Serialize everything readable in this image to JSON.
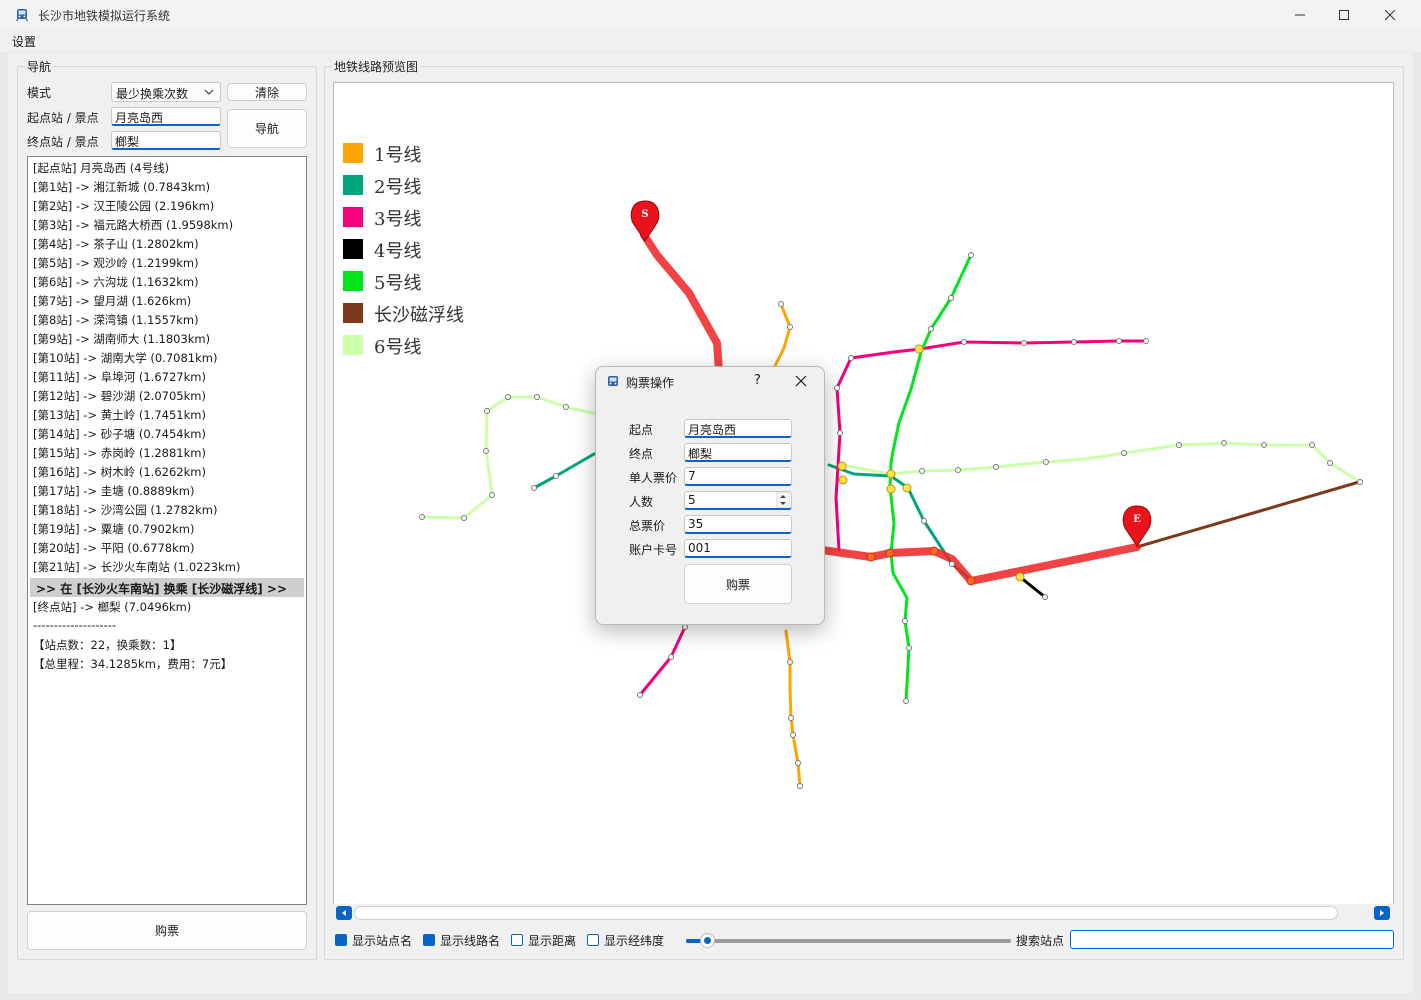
{
  "window": {
    "title": "长沙市地铁模拟运行系统"
  },
  "menu": {
    "settings": "设置"
  },
  "nav": {
    "group_title": "导航",
    "mode_label": "模式",
    "mode_value": "最少换乘次数",
    "clear_button": "清除",
    "start_label": "起点站 / 景点",
    "start_value": "月亮岛西",
    "end_label": "终点站 / 景点",
    "end_value": "榔梨",
    "navigate_button": "导航",
    "buy_button": "购票"
  },
  "route": {
    "lines": [
      "[起点站] 月亮岛西 (4号线)",
      "[第1站] -> 湘江新城  (0.7843km)",
      "[第2站] -> 汉王陵公园  (2.196km)",
      "[第3站] -> 福元路大桥西  (1.9598km)",
      "[第4站] -> 茶子山  (1.2802km)",
      "[第5站] -> 观沙岭  (1.2199km)",
      "[第6站] -> 六沟垅  (1.1632km)",
      "[第7站] -> 望月湖  (1.626km)",
      "[第8站] -> 溁湾镇  (1.1557km)",
      "[第9站] -> 湖南师大  (1.1803km)",
      "[第10站] -> 湖南大学  (0.7081km)",
      "[第11站] -> 阜埠河  (1.6727km)",
      "[第12站] -> 碧沙湖  (2.0705km)",
      "[第13站] -> 黄土岭  (1.7451km)",
      "[第14站] -> 砂子塘  (0.7454km)",
      "[第15站] -> 赤岗岭  (1.2881km)",
      "[第16站] -> 树木岭  (1.6262km)",
      "[第17站] -> 圭塘  (0.8889km)",
      "[第18站] -> 沙湾公园  (1.2782km)",
      "[第19站] -> 粟塘  (0.7902km)",
      "[第20站] -> 平阳  (0.6778km)",
      "[第21站] -> 长沙火车南站  (1.0223km)"
    ],
    "transfer": ">> 在 [长沙火车南站] 换乘 [长沙磁浮线] >>",
    "end_line": "[终点站] -> 榔梨  (7.0496km)",
    "divider": "--------------------",
    "summary1": "【站点数：22，换乘数：1】",
    "summary2": "【总里程：34.1285km，费用：7元】"
  },
  "map": {
    "group_title": "地铁线路预览图",
    "start_marker": "S",
    "end_marker": "E",
    "legend": [
      {
        "name": "1号线",
        "color": "#ffa500"
      },
      {
        "name": "2号线",
        "color": "#00a57e"
      },
      {
        "name": "3号线",
        "color": "#f5007a"
      },
      {
        "name": "4号线",
        "color": "#000000"
      },
      {
        "name": "5号线",
        "color": "#00e51e"
      },
      {
        "name": "长沙磁浮线",
        "color": "#7b3a1a"
      },
      {
        "name": "6号线",
        "color": "#ccffaa"
      }
    ]
  },
  "controls": {
    "show_station_names": "显示站点名",
    "show_line_names": "显示线路名",
    "show_distance": "显示距离",
    "show_latlng": "显示经纬度",
    "search_label": "搜索站点",
    "search_value": "",
    "zoom_level": 0.06
  },
  "dialog": {
    "title": "购票操作",
    "help": "?",
    "start_label": "起点",
    "start_value": "月亮岛西",
    "end_label": "终点",
    "end_value": "榔梨",
    "unit_price_label": "单人票价",
    "unit_price_value": "7",
    "count_label": "人数",
    "count_value": "5",
    "total_label": "总票价",
    "total_value": "35",
    "card_label": "账户卡号",
    "card_value": "001",
    "buy_button": "购票"
  }
}
